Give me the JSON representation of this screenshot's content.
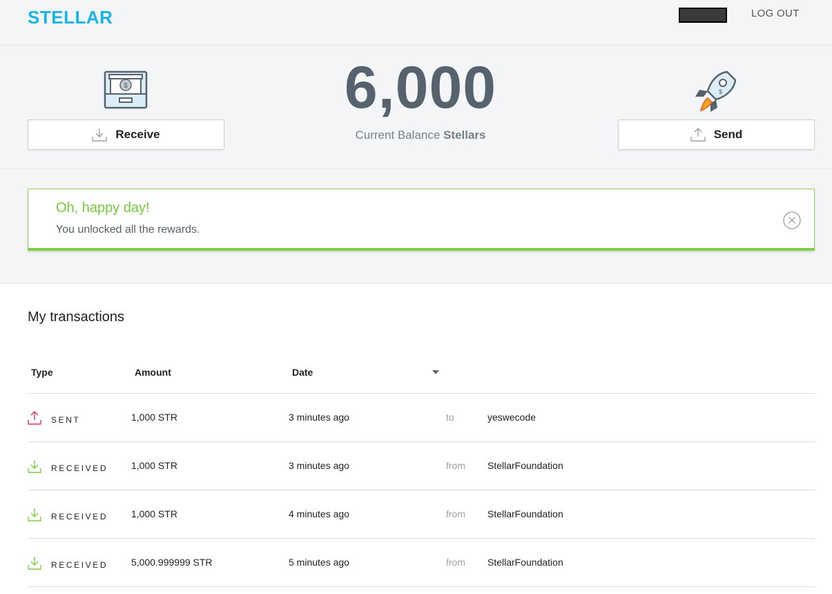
{
  "header": {
    "logo": "STELLAR",
    "logout_label": "LOG OUT"
  },
  "balance": {
    "amount": "6,000",
    "label_prefix": "Current Balance",
    "label_unit": "Stellars"
  },
  "actions": {
    "receive_label": "Receive",
    "send_label": "Send"
  },
  "alert": {
    "title": "Oh, happy day!",
    "message": "You unlocked all the rewards."
  },
  "transactions": {
    "title": "My transactions",
    "columns": {
      "type": "Type",
      "amount": "Amount",
      "date": "Date"
    },
    "rows": [
      {
        "type": "SENT",
        "amount": "1,000 STR",
        "date": "3 minutes ago",
        "direction": "to",
        "party": "yeswecode",
        "kind": "sent"
      },
      {
        "type": "RECEIVED",
        "amount": "1,000 STR",
        "date": "3 minutes ago",
        "direction": "from",
        "party": "StellarFoundation",
        "kind": "received"
      },
      {
        "type": "RECEIVED",
        "amount": "1,000 STR",
        "date": "4 minutes ago",
        "direction": "from",
        "party": "StellarFoundation",
        "kind": "received"
      },
      {
        "type": "RECEIVED",
        "amount": "5,000.999999 STR",
        "date": "5 minutes ago",
        "direction": "from",
        "party": "StellarFoundation",
        "kind": "received"
      }
    ]
  },
  "colors": {
    "brand": "#1ab3e6",
    "success": "#7ccd43",
    "sent": "#e0345a",
    "received": "#7ccd43"
  }
}
